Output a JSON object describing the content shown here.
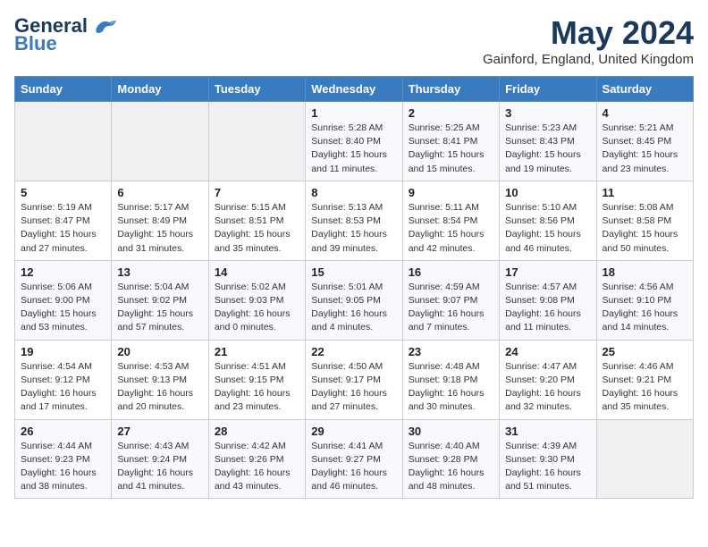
{
  "header": {
    "logo_line1": "General",
    "logo_line2": "Blue",
    "month_year": "May 2024",
    "location": "Gainford, England, United Kingdom"
  },
  "days_of_week": [
    "Sunday",
    "Monday",
    "Tuesday",
    "Wednesday",
    "Thursday",
    "Friday",
    "Saturday"
  ],
  "weeks": [
    [
      {
        "day": "",
        "info": ""
      },
      {
        "day": "",
        "info": ""
      },
      {
        "day": "",
        "info": ""
      },
      {
        "day": "1",
        "info": "Sunrise: 5:28 AM\nSunset: 8:40 PM\nDaylight: 15 hours\nand 11 minutes."
      },
      {
        "day": "2",
        "info": "Sunrise: 5:25 AM\nSunset: 8:41 PM\nDaylight: 15 hours\nand 15 minutes."
      },
      {
        "day": "3",
        "info": "Sunrise: 5:23 AM\nSunset: 8:43 PM\nDaylight: 15 hours\nand 19 minutes."
      },
      {
        "day": "4",
        "info": "Sunrise: 5:21 AM\nSunset: 8:45 PM\nDaylight: 15 hours\nand 23 minutes."
      }
    ],
    [
      {
        "day": "5",
        "info": "Sunrise: 5:19 AM\nSunset: 8:47 PM\nDaylight: 15 hours\nand 27 minutes."
      },
      {
        "day": "6",
        "info": "Sunrise: 5:17 AM\nSunset: 8:49 PM\nDaylight: 15 hours\nand 31 minutes."
      },
      {
        "day": "7",
        "info": "Sunrise: 5:15 AM\nSunset: 8:51 PM\nDaylight: 15 hours\nand 35 minutes."
      },
      {
        "day": "8",
        "info": "Sunrise: 5:13 AM\nSunset: 8:53 PM\nDaylight: 15 hours\nand 39 minutes."
      },
      {
        "day": "9",
        "info": "Sunrise: 5:11 AM\nSunset: 8:54 PM\nDaylight: 15 hours\nand 42 minutes."
      },
      {
        "day": "10",
        "info": "Sunrise: 5:10 AM\nSunset: 8:56 PM\nDaylight: 15 hours\nand 46 minutes."
      },
      {
        "day": "11",
        "info": "Sunrise: 5:08 AM\nSunset: 8:58 PM\nDaylight: 15 hours\nand 50 minutes."
      }
    ],
    [
      {
        "day": "12",
        "info": "Sunrise: 5:06 AM\nSunset: 9:00 PM\nDaylight: 15 hours\nand 53 minutes."
      },
      {
        "day": "13",
        "info": "Sunrise: 5:04 AM\nSunset: 9:02 PM\nDaylight: 15 hours\nand 57 minutes."
      },
      {
        "day": "14",
        "info": "Sunrise: 5:02 AM\nSunset: 9:03 PM\nDaylight: 16 hours\nand 0 minutes."
      },
      {
        "day": "15",
        "info": "Sunrise: 5:01 AM\nSunset: 9:05 PM\nDaylight: 16 hours\nand 4 minutes."
      },
      {
        "day": "16",
        "info": "Sunrise: 4:59 AM\nSunset: 9:07 PM\nDaylight: 16 hours\nand 7 minutes."
      },
      {
        "day": "17",
        "info": "Sunrise: 4:57 AM\nSunset: 9:08 PM\nDaylight: 16 hours\nand 11 minutes."
      },
      {
        "day": "18",
        "info": "Sunrise: 4:56 AM\nSunset: 9:10 PM\nDaylight: 16 hours\nand 14 minutes."
      }
    ],
    [
      {
        "day": "19",
        "info": "Sunrise: 4:54 AM\nSunset: 9:12 PM\nDaylight: 16 hours\nand 17 minutes."
      },
      {
        "day": "20",
        "info": "Sunrise: 4:53 AM\nSunset: 9:13 PM\nDaylight: 16 hours\nand 20 minutes."
      },
      {
        "day": "21",
        "info": "Sunrise: 4:51 AM\nSunset: 9:15 PM\nDaylight: 16 hours\nand 23 minutes."
      },
      {
        "day": "22",
        "info": "Sunrise: 4:50 AM\nSunset: 9:17 PM\nDaylight: 16 hours\nand 27 minutes."
      },
      {
        "day": "23",
        "info": "Sunrise: 4:48 AM\nSunset: 9:18 PM\nDaylight: 16 hours\nand 30 minutes."
      },
      {
        "day": "24",
        "info": "Sunrise: 4:47 AM\nSunset: 9:20 PM\nDaylight: 16 hours\nand 32 minutes."
      },
      {
        "day": "25",
        "info": "Sunrise: 4:46 AM\nSunset: 9:21 PM\nDaylight: 16 hours\nand 35 minutes."
      }
    ],
    [
      {
        "day": "26",
        "info": "Sunrise: 4:44 AM\nSunset: 9:23 PM\nDaylight: 16 hours\nand 38 minutes."
      },
      {
        "day": "27",
        "info": "Sunrise: 4:43 AM\nSunset: 9:24 PM\nDaylight: 16 hours\nand 41 minutes."
      },
      {
        "day": "28",
        "info": "Sunrise: 4:42 AM\nSunset: 9:26 PM\nDaylight: 16 hours\nand 43 minutes."
      },
      {
        "day": "29",
        "info": "Sunrise: 4:41 AM\nSunset: 9:27 PM\nDaylight: 16 hours\nand 46 minutes."
      },
      {
        "day": "30",
        "info": "Sunrise: 4:40 AM\nSunset: 9:28 PM\nDaylight: 16 hours\nand 48 minutes."
      },
      {
        "day": "31",
        "info": "Sunrise: 4:39 AM\nSunset: 9:30 PM\nDaylight: 16 hours\nand 51 minutes."
      },
      {
        "day": "",
        "info": ""
      }
    ]
  ]
}
